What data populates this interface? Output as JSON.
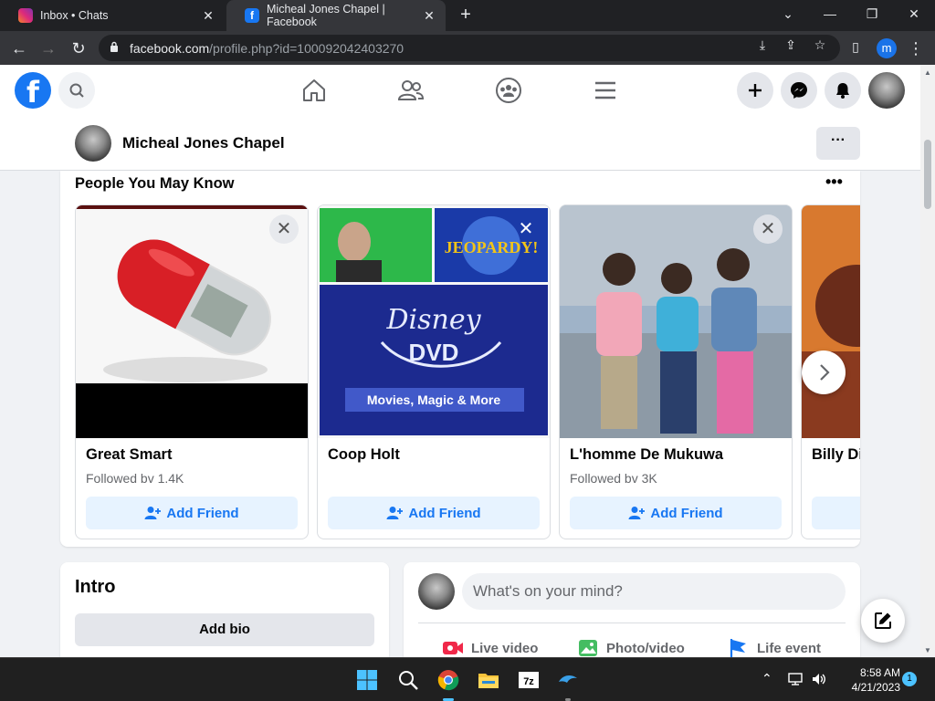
{
  "browser": {
    "tabs": [
      {
        "title": "Inbox • Chats",
        "favicon": "instagram-icon",
        "active": false
      },
      {
        "title": "Micheal Jones Chapel | Facebook",
        "favicon": "facebook-icon",
        "active": true
      }
    ],
    "url_host": "facebook.com",
    "url_path": "/profile.php?id=100092042403270",
    "profile_initial": "m"
  },
  "fb": {
    "logo_letter": "f",
    "brand_color": "#1877f2"
  },
  "profile": {
    "name": "Micheal Jones Chapel",
    "more_label": "···"
  },
  "pymk": {
    "title": "People You May Know",
    "more_label": "•••",
    "add_label": "Add Friend",
    "people": [
      {
        "name": "Great Smart",
        "followers": "Followed bv 1.4K"
      },
      {
        "name": "Coop Holt",
        "followers": ""
      },
      {
        "name": "L'homme De Mukuwa",
        "followers": "Followed bv 3K"
      },
      {
        "name": "Billy Di",
        "followers": ""
      }
    ],
    "image_texts": {
      "jeopardy": "JEOPARDY!",
      "disney": "Disney",
      "dvd": "DVD",
      "tagline": "Movies, Magic & More"
    }
  },
  "intro": {
    "title": "Intro",
    "add_bio": "Add bio"
  },
  "composer": {
    "placeholder": "What's on your mind?",
    "actions": [
      "Live video",
      "Photo/video",
      "Life event"
    ]
  },
  "taskbar": {
    "time": "8:58 AM",
    "date": "4/21/2023",
    "notifications": "1"
  }
}
